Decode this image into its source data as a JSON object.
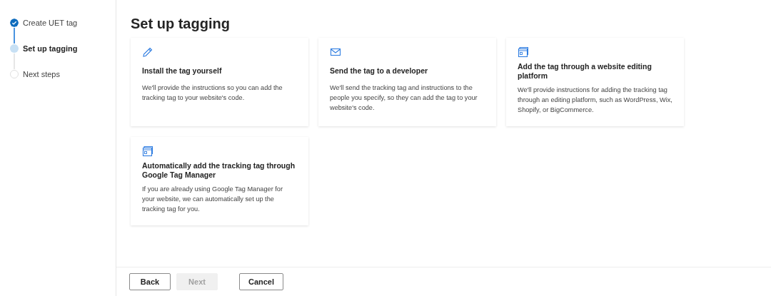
{
  "steps": [
    {
      "label": "Create UET tag",
      "kind": "done"
    },
    {
      "label": "Set up tagging",
      "kind": "current"
    },
    {
      "label": "Next steps",
      "kind": "pending"
    }
  ],
  "title": "Set up tagging",
  "cards": [
    {
      "kind": "pencil",
      "title": "Install the tag yourself",
      "text": "We'll provide the instructions so you can add the tracking tag to your website's code."
    },
    {
      "kind": "envelope",
      "title": "Send the tag to a developer",
      "text": "We'll send the tracking tag and instructions to the people you specify, so they can add the tag to your website's code."
    },
    {
      "kind": "browser",
      "title": "Add the tag through a website editing platform",
      "text": "We'll provide instructions for adding the tracking tag through an editing platform, such as WordPress, Wix, Shopify, or BigCommerce."
    },
    {
      "kind": "browser",
      "title": "Automatically add the tracking tag through Google Tag Manager",
      "text": "If you are already using Google Tag Manager for your website, we can automatically set up the tracking tag for you."
    }
  ],
  "buttons": [
    {
      "label": "Back",
      "disabled": false
    },
    {
      "label": "Next",
      "disabled": true
    },
    {
      "label": "Cancel",
      "disabled": false
    }
  ]
}
